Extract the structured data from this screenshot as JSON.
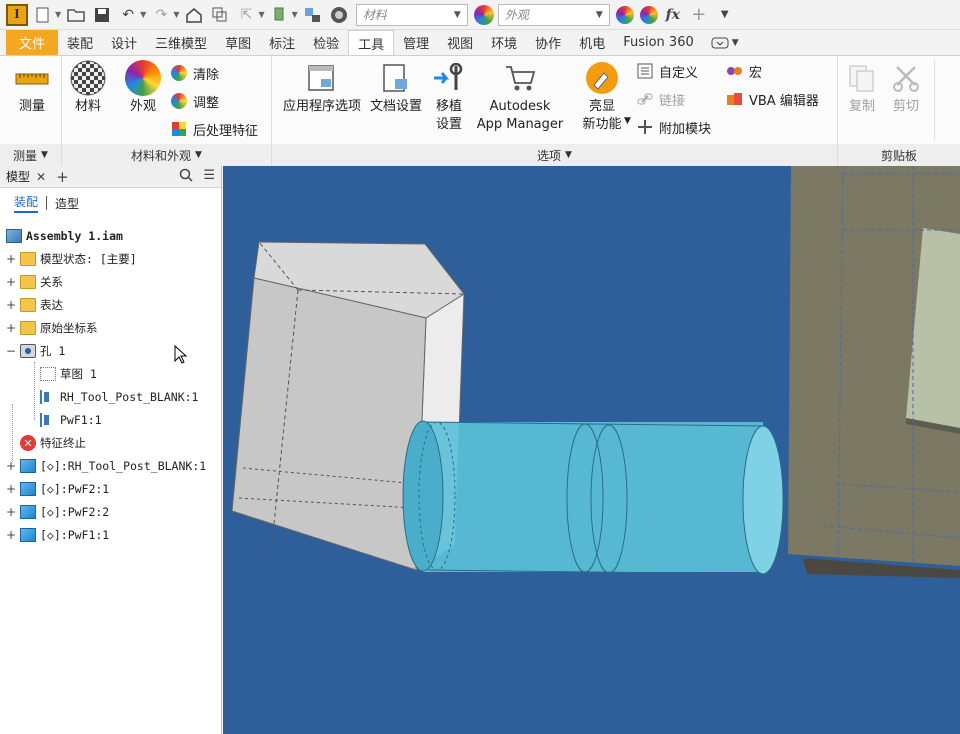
{
  "app": {
    "logo_letter": "I"
  },
  "qat": {
    "material_placeholder": "材料",
    "appearance_placeholder": "外观",
    "fx": "fx"
  },
  "tabs": [
    {
      "label": "文件"
    },
    {
      "label": "装配"
    },
    {
      "label": "设计"
    },
    {
      "label": "三维模型"
    },
    {
      "label": "草图"
    },
    {
      "label": "标注"
    },
    {
      "label": "检验"
    },
    {
      "label": "工具"
    },
    {
      "label": "管理"
    },
    {
      "label": "视图"
    },
    {
      "label": "环境"
    },
    {
      "label": "协作"
    },
    {
      "label": "机电"
    },
    {
      "label": "Fusion 360"
    }
  ],
  "ribbon": {
    "measure": {
      "label": "测量",
      "panel": "测量"
    },
    "materials_panel": {
      "panel": "材料和外观",
      "material": "材料",
      "appearance": "外观",
      "clear": "清除",
      "adjust": "调整",
      "postprocess": "后处理特征"
    },
    "options_panel": {
      "panel": "选项",
      "app_options": "应用程序选项",
      "doc_settings": "文档设置",
      "migrate_line1": "移植",
      "migrate_line2": "设置",
      "autodesk_line1": "Autodesk",
      "autodesk_line2": "App Manager",
      "highlight_line1": "亮显",
      "highlight_line2": "新功能",
      "customize": "自定义",
      "link": "链接",
      "addins": "附加模块",
      "macro": "宏",
      "vba": "VBA 编辑器"
    },
    "clipboard_panel": {
      "panel": "剪贴板",
      "copy": "复制",
      "cut": "剪切"
    }
  },
  "browser": {
    "tab": "模型",
    "modes": {
      "assembly": "装配",
      "modeling": "造型"
    },
    "root": "Assembly 1.iam",
    "items": [
      "模型状态: [主要]",
      "关系",
      "表达",
      "原始坐标系",
      "孔 1",
      "草图 1",
      "RH_Tool_Post_BLANK:1",
      "PwF1:1",
      "特征终止",
      "[◇]:RH_Tool_Post_BLANK:1",
      "[◇]:PwF2:1",
      "[◇]:PwF2:2",
      "[◇]:PwF1:1"
    ]
  },
  "colors": {
    "file_tab": "#f5a623",
    "viewport": "#2e5f9b",
    "cylinder": "#5bc0d8",
    "accent": "#1a6fc4"
  }
}
